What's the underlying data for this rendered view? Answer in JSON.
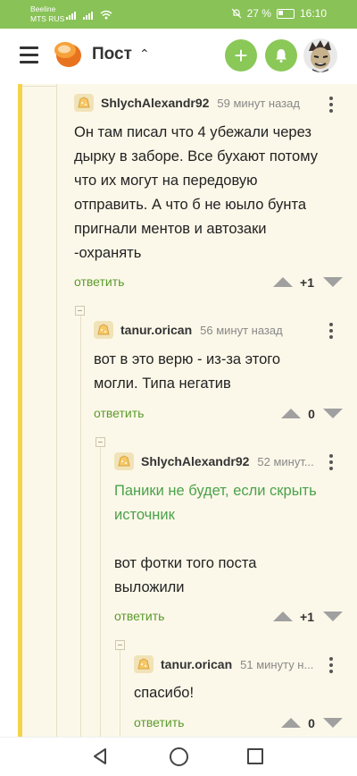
{
  "status_bar": {
    "carrier_line1": "Beeline",
    "carrier_line2": "MTS RUS",
    "battery": "27 %",
    "time": "16:10"
  },
  "header": {
    "title": "Пост"
  },
  "colors": {
    "accent": "#8ac858",
    "status_bar": "#89c257",
    "reply_link": "#5b9a2d",
    "quote_text": "#4aa24b",
    "thread_bg": "#fcf8e9",
    "thread_marker": "#f4d24a"
  },
  "comments": [
    {
      "author": "ShlychAlexandr92",
      "time": "59 минут назад",
      "text": "Он там писал что 4 убежали через\nдырку в заборе. Все бухают потому\nчто их могут на передовую\nотправить. А что б не юыло бунта\nпригнали ментов и автозаки\n-охранять",
      "reply": "ответить",
      "score": "+1"
    },
    {
      "author": "tanur.orican",
      "time": "56 минут назад",
      "text": "вот в это верю - из-за этого\nмогли. Типа негатив",
      "reply": "ответить",
      "score": "0"
    },
    {
      "author": "ShlychAlexandr92",
      "time": "52 минут...",
      "quote": "Паники не будет, если скрыть\nисточник",
      "text": "вот фотки того поста\nвыложили",
      "reply": "ответить",
      "score": "+1"
    },
    {
      "author": "tanur.orican",
      "time": "51 минуту н...",
      "text": "спасибо!",
      "reply": "ответить",
      "score": "0"
    }
  ]
}
